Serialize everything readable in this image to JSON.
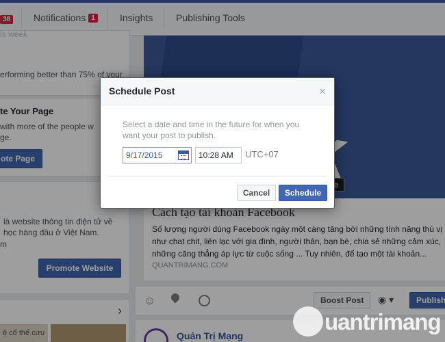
{
  "nav": {
    "left_badge": "38",
    "notifications_label": "Notifications",
    "notifications_badge": "1",
    "insights_label": "Insights",
    "publishing_tools_label": "Publishing Tools"
  },
  "left": {
    "week_snippet": "is week",
    "performing": "erforming better than 75% of your",
    "promote_title": "te Your Page",
    "promote_desc_1": "with more of the people w",
    "promote_desc_2": "ge.",
    "promote_page_button": "ote Page",
    "website_desc_1": "là website thông tin điện tử về",
    "website_desc_2": "học hàng đầu ở Việt Nam.",
    "website_desc_3": "m",
    "promote_website_button": "Promote Website",
    "bottom_snippet": "ệ cổ thể cứu"
  },
  "main": {
    "hero_text": "book",
    "change_image_snippet": "ge",
    "article_title": "Cách tạo tài khoản Facebook",
    "article_body": "Số lượng người dùng Facebook ngày một càng tăng bởi những tính năng thú vị như chat chit, liên lạc với gia đình, người thân, bạn bè, chia sẻ những cảm xúc, những căng thẳng áp lực từ cuộc sống ... Tuy nhiên, để tạo một tài khoản...",
    "article_source": "QUANTRIMANG.COM",
    "boost_post_button": "Boost Post",
    "publish_button": "Publish",
    "page_name": "Quản Trị Mạng"
  },
  "modal": {
    "title": "Schedule Post",
    "close_glyph": "×",
    "description": "Select a date and time in the future for when you want your post to publish.",
    "date_value": "9/17/2015",
    "time_value": "10:28 AM",
    "timezone": "UTC+07",
    "cancel_button": "Cancel",
    "schedule_button": "Schedule"
  },
  "watermark": "uantrimang",
  "colors": {
    "brand_blue": "#3b5998",
    "button_blue": "#4267b2",
    "badge_red": "#e41e3f"
  }
}
